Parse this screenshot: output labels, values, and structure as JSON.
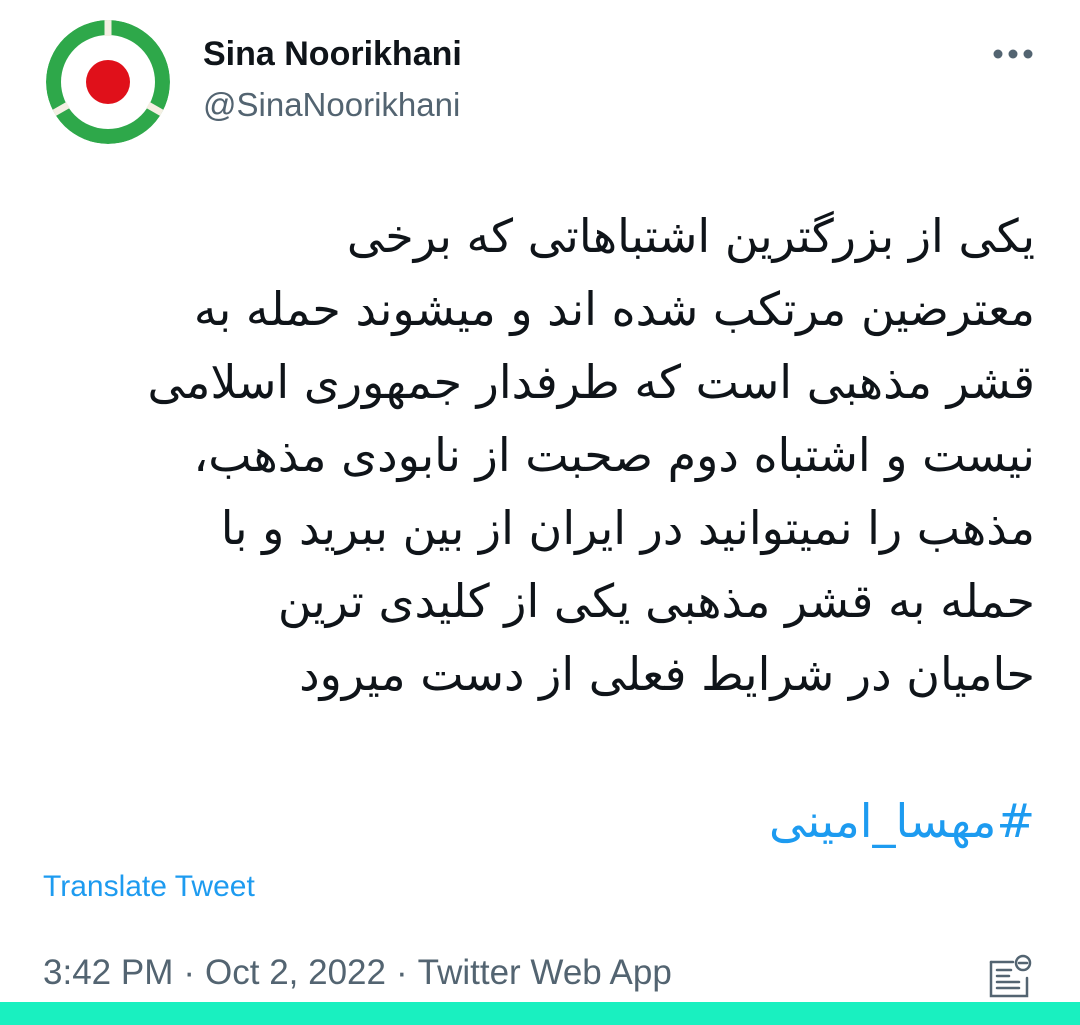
{
  "user": {
    "display_name": "Sina Noorikhani",
    "handle": "@SinaNoorikhani"
  },
  "avatar": {
    "icon": "roundel-icon",
    "colors": {
      "outer_ring": "#2ea84a",
      "inner_ring": "#ffffff",
      "center": "#e0101a",
      "divider": "#f4efe3"
    }
  },
  "more_button": {
    "icon": "ellipsis-icon"
  },
  "tweet": {
    "lines": [
      "یکی از بزرگترین اشتباهاتی که برخی",
      "معترضین مرتکب شده اند و میشوند حمله به",
      "قشر مذهبی است که طرفدار جمهوری اسلامی",
      "نیست و اشتباه دوم صحبت از نابودی مذهب،",
      "مذهب را نمیتوانید در ایران از بین ببرید و با",
      "حمله به قشر مذهبی یکی از کلیدی ترین",
      "حامیان در شرایط فعلی از دست میرود"
    ],
    "hashtag": "#مهسا_امینی",
    "translate_label": "Translate Tweet"
  },
  "meta": {
    "time": "3:42 PM",
    "separator": "·",
    "date": "Oct 2, 2022",
    "source": "Twitter Web App"
  },
  "analytics_button": {
    "icon": "analytics-icon"
  },
  "colors": {
    "text": "#0f1419",
    "secondary_text": "#536471",
    "link": "#1d9bf0",
    "bottom_bar": "#19f0c0"
  }
}
